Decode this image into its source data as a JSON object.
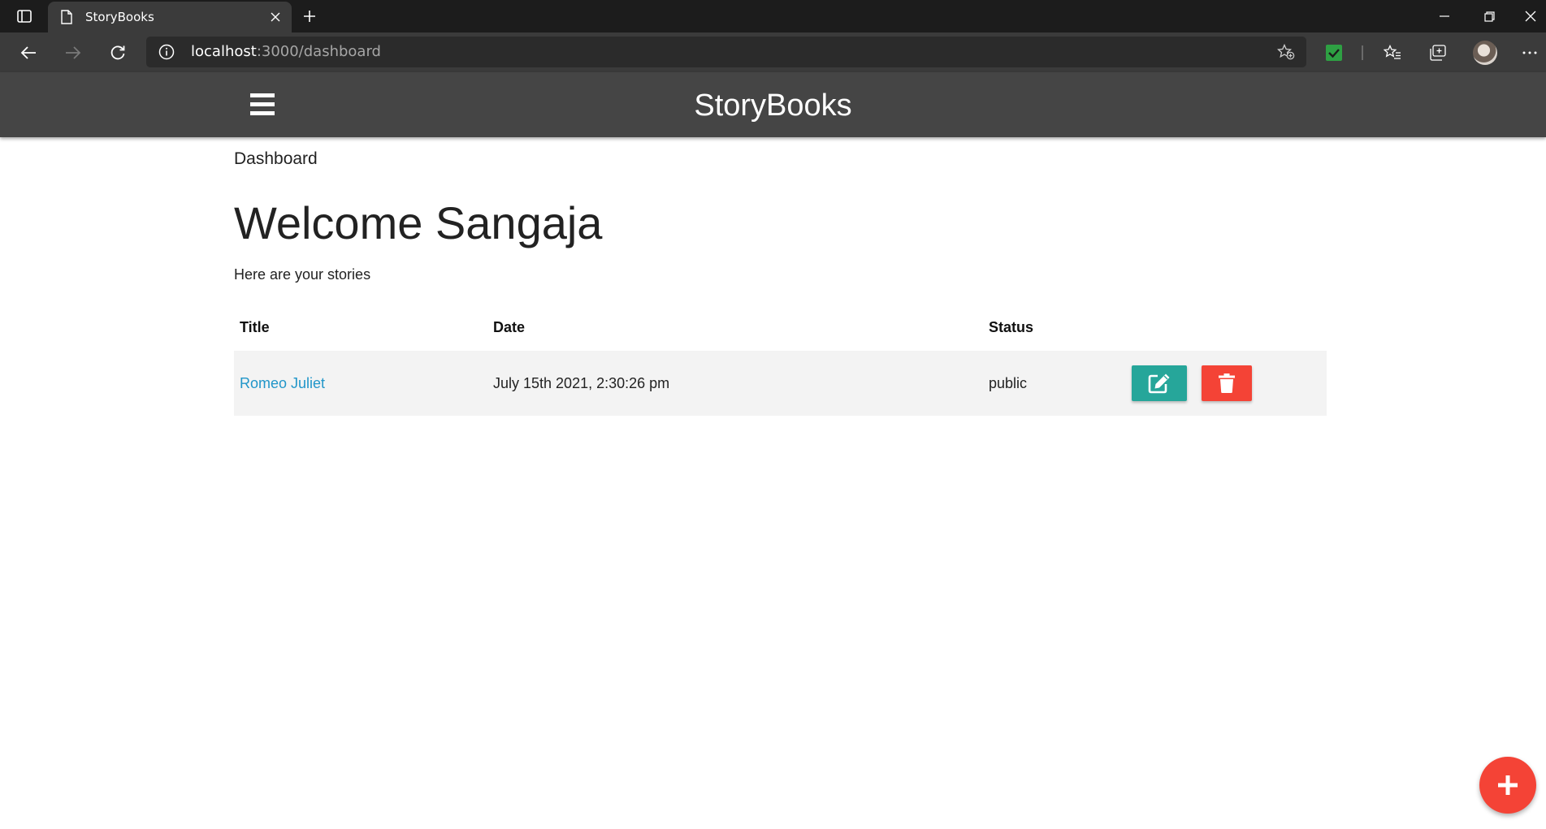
{
  "browser": {
    "tab": {
      "title": "StoryBooks"
    },
    "address": {
      "host": "localhost",
      "path": ":3000/dashboard"
    },
    "colors": {
      "chrome_dark": "#1c1c1c",
      "toolbar": "#3b3b3b",
      "extension_green": "#2ea043"
    }
  },
  "app": {
    "brand": "StoryBooks",
    "colors": {
      "navbar": "#454545",
      "link": "#2196c9",
      "edit": "#26a69a",
      "delete": "#f44336"
    }
  },
  "page": {
    "breadcrumb": "Dashboard",
    "welcome": "Welcome Sangaja",
    "subtitle": "Here are your stories"
  },
  "table": {
    "headers": {
      "title": "Title",
      "date": "Date",
      "status": "Status"
    },
    "rows": [
      {
        "title": "Romeo Juliet",
        "date": "July 15th 2021, 2:30:26 pm",
        "status": "public"
      }
    ]
  },
  "icons": {
    "edit": "pencil-square-icon",
    "delete": "trash-icon",
    "fab": "plus-icon",
    "menu": "hamburger-icon"
  }
}
